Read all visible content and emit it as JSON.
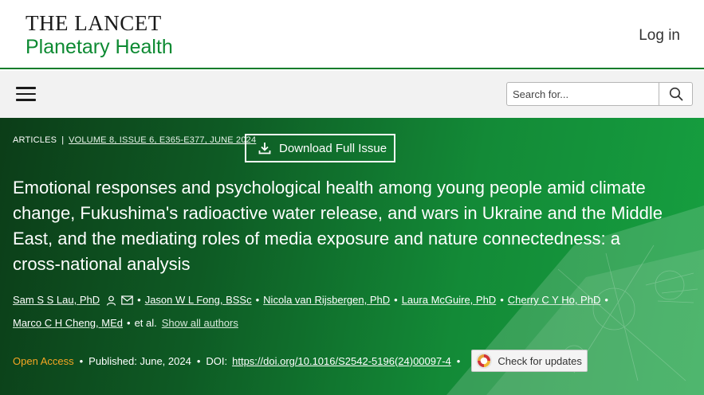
{
  "brand": {
    "line1": "THE LANCET",
    "line2": "Planetary Health",
    "login": "Log in"
  },
  "nav": {
    "search_placeholder": "Search for..."
  },
  "article": {
    "type": "ARTICLES",
    "volume": "VOLUME 8, ISSUE 6, E365-E377, JUNE 2024",
    "download_label": "Download Full Issue",
    "title": "Emotional responses and psychological health among young people amid climate change, Fukushima's radioactive water release, and wars in Ukraine and the Middle East, and the mediating roles of media exposure and nature connectedness: a cross-national analysis",
    "authors": [
      "Sam S S Lau, PhD",
      "Jason W L Fong, BSSc",
      "Nicola van Rijsbergen, PhD",
      "Laura McGuire, PhD",
      "Cherry C Y Ho, PhD",
      "Marco C H Cheng, MEd"
    ],
    "et_al": "et al.",
    "show_all": "Show all authors",
    "open_access": "Open Access",
    "published": "Published: June, 2024",
    "doi_label": "DOI:",
    "doi": "https://doi.org/10.1016/S2542-5196(24)00097-4",
    "check_updates": "Check for updates"
  },
  "colors": {
    "brand_green": "#0d8a32",
    "hero_dark": "#0c3d18",
    "hero_light": "#16a040",
    "open_access": "#f5a623"
  },
  "icons": [
    "menu-icon",
    "search-icon",
    "download-icon",
    "person-icon",
    "envelope-icon",
    "check-for-updates-icon"
  ]
}
